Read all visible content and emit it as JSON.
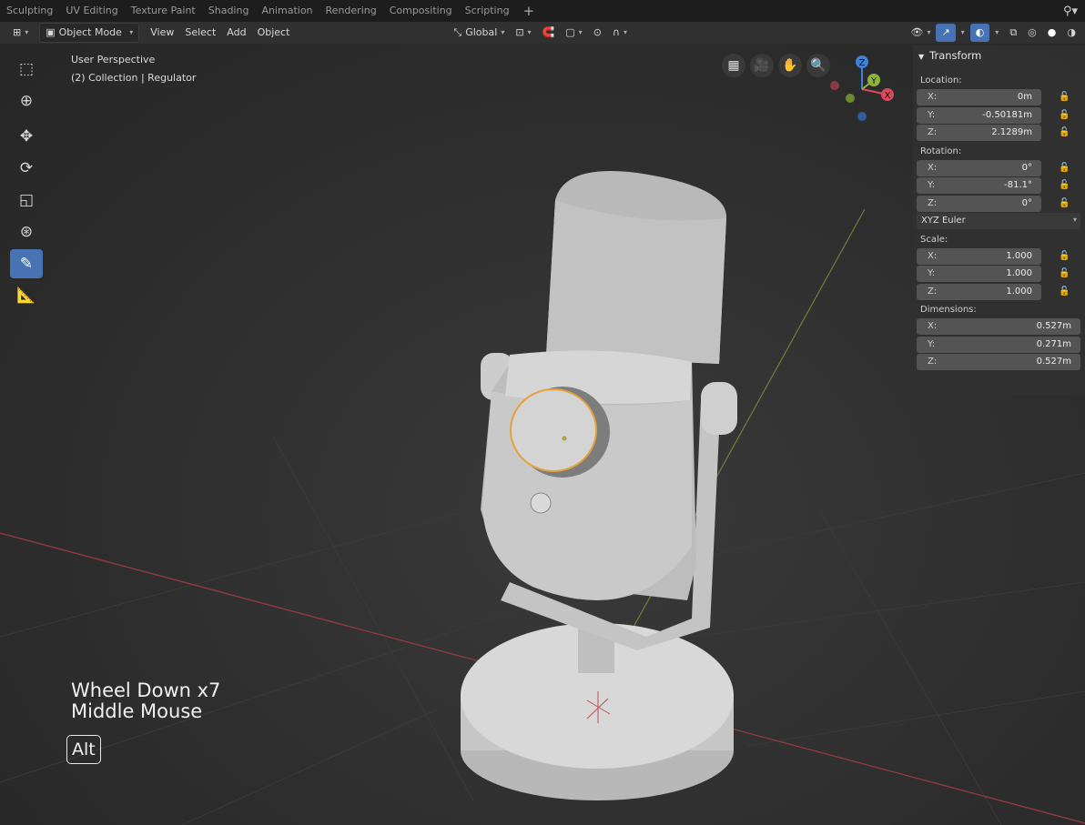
{
  "workspace_tabs": [
    "Sculpting",
    "UV Editing",
    "Texture Paint",
    "Shading",
    "Animation",
    "Rendering",
    "Compositing",
    "Scripting"
  ],
  "header": {
    "mode": "Object Mode",
    "menus": [
      "View",
      "Select",
      "Add",
      "Object"
    ],
    "orientation": "Global"
  },
  "viewport": {
    "perspective": "User Perspective",
    "collection": "(2) Collection | Regulator"
  },
  "keys": {
    "line1": "Wheel Down x7",
    "line2": "Middle Mouse",
    "modifier": "Alt"
  },
  "gizmo": {
    "x": "X",
    "y": "Y",
    "z": "Z"
  },
  "npanel": {
    "title": "Transform",
    "location_label": "Location:",
    "location": [
      {
        "axis": "X:",
        "value": "0m"
      },
      {
        "axis": "Y:",
        "value": "-0.50181m"
      },
      {
        "axis": "Z:",
        "value": "2.1289m"
      }
    ],
    "rotation_label": "Rotation:",
    "rotation": [
      {
        "axis": "X:",
        "value": "0°"
      },
      {
        "axis": "Y:",
        "value": "-81.1°"
      },
      {
        "axis": "Z:",
        "value": "0°"
      }
    ],
    "rotation_mode": "XYZ Euler",
    "scale_label": "Scale:",
    "scale": [
      {
        "axis": "X:",
        "value": "1.000"
      },
      {
        "axis": "Y:",
        "value": "1.000"
      },
      {
        "axis": "Z:",
        "value": "1.000"
      }
    ],
    "dimensions_label": "Dimensions:",
    "dimensions": [
      {
        "axis": "X:",
        "value": "0.527m"
      },
      {
        "axis": "Y:",
        "value": "0.271m"
      },
      {
        "axis": "Z:",
        "value": "0.527m"
      }
    ]
  },
  "colors": {
    "active_tool": "#4772b3",
    "axis_x": "#d94a5a",
    "axis_y": "#8db43c",
    "axis_z": "#3e82d8",
    "selection_outline": "#e6a13a"
  }
}
